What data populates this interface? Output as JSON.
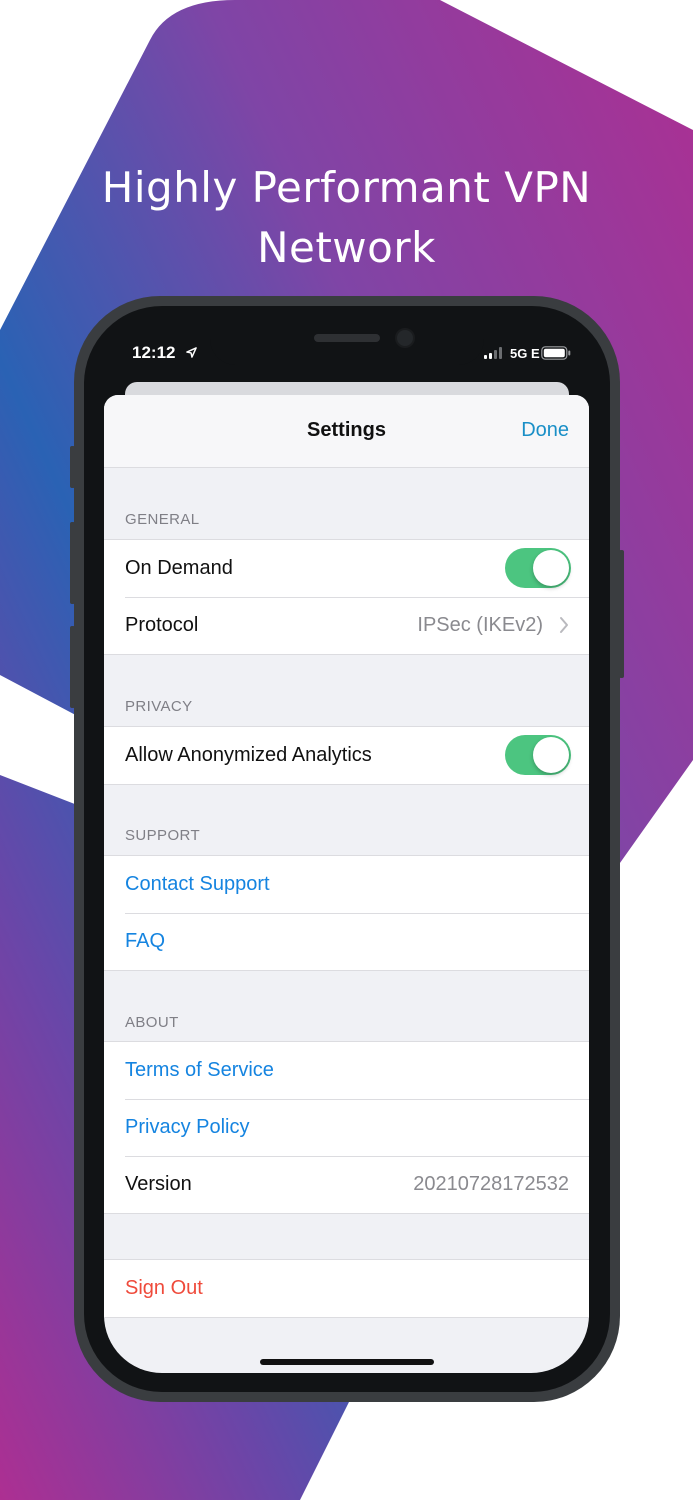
{
  "marketing": {
    "headline_line1": "Highly Performant VPN",
    "headline_line2": "Network"
  },
  "colors": {
    "gradient_pink": "#ad2f92",
    "gradient_purple": "#8a3ea0",
    "gradient_blue": "#2a62b4",
    "toggle_on": "#4cc580",
    "link": "#1584e0",
    "danger": "#ef4a3b",
    "nav_accent": "#1a8fc7"
  },
  "status_bar": {
    "time": "12:12",
    "network": "5G E",
    "location_icon": "location-arrow-icon",
    "signal_icon": "cellular-signal-icon",
    "battery_icon": "battery-icon"
  },
  "nav": {
    "title": "Settings",
    "done_label": "Done"
  },
  "sections": {
    "general": {
      "header": "GENERAL",
      "on_demand_label": "On Demand",
      "on_demand_enabled": true,
      "protocol_label": "Protocol",
      "protocol_value": "IPSec (IKEv2)"
    },
    "privacy": {
      "header": "PRIVACY",
      "analytics_label": "Allow Anonymized Analytics",
      "analytics_enabled": true
    },
    "support": {
      "header": "SUPPORT",
      "contact_label": "Contact Support",
      "faq_label": "FAQ"
    },
    "about": {
      "header": "ABOUT",
      "terms_label": "Terms of Service",
      "privacy_label": "Privacy Policy",
      "version_label": "Version",
      "version_value": "20210728172532"
    },
    "account": {
      "sign_out_label": "Sign Out"
    }
  }
}
